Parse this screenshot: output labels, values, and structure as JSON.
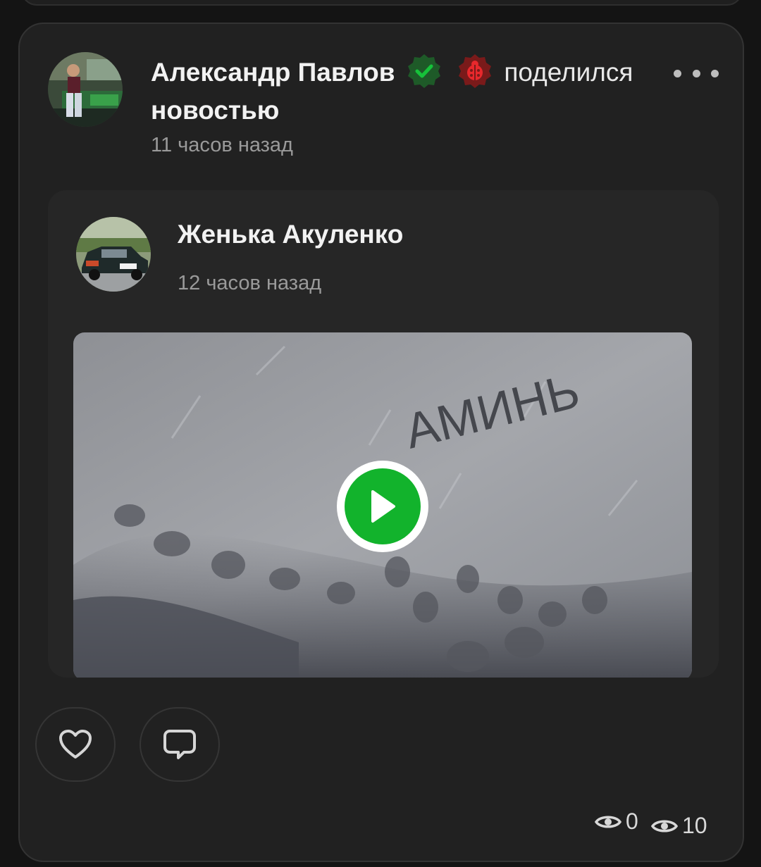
{
  "post": {
    "author_name": "Александр Павлов",
    "shared_text": "поделился",
    "shared_text_cont": "новостью",
    "time": "11 часов назад"
  },
  "repost": {
    "author_name": "Женька Акуленко",
    "time": "12 часов назад",
    "video_caption": "АМИНЬ"
  },
  "stats": {
    "likes_views": "0",
    "views": "10"
  },
  "colors": {
    "accent_green": "#12b32c",
    "badge_green": "#1e5a28",
    "badge_red": "#7a1a1a"
  }
}
